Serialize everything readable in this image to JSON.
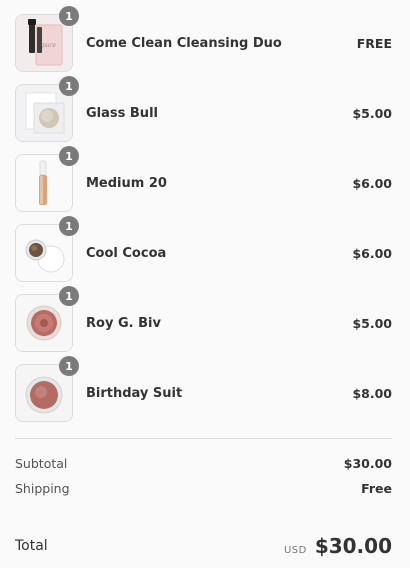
{
  "items": [
    {
      "name": "Come Clean Cleansing Duo",
      "price": "FREE",
      "qty": "1",
      "icon": "cleansing-duo-image"
    },
    {
      "name": "Glass Bull",
      "price": "$5.00",
      "qty": "1",
      "icon": "glass-bull-image"
    },
    {
      "name": "Medium 20",
      "price": "$6.00",
      "qty": "1",
      "icon": "medium-20-image"
    },
    {
      "name": "Cool Cocoa",
      "price": "$6.00",
      "qty": "1",
      "icon": "cool-cocoa-image"
    },
    {
      "name": "Roy G. Biv",
      "price": "$5.00",
      "qty": "1",
      "icon": "roy-g-biv-image"
    },
    {
      "name": "Birthday Suit",
      "price": "$8.00",
      "qty": "1",
      "icon": "birthday-suit-image"
    }
  ],
  "subtotal": {
    "label": "Subtotal",
    "value": "$30.00"
  },
  "shipping": {
    "label": "Shipping",
    "value": "Free"
  },
  "total": {
    "label": "Total",
    "currency": "USD",
    "value": "$30.00"
  },
  "colors": {
    "qty_badge": "#7a7a7a",
    "divider": "#dddddd",
    "text": "#333333"
  }
}
